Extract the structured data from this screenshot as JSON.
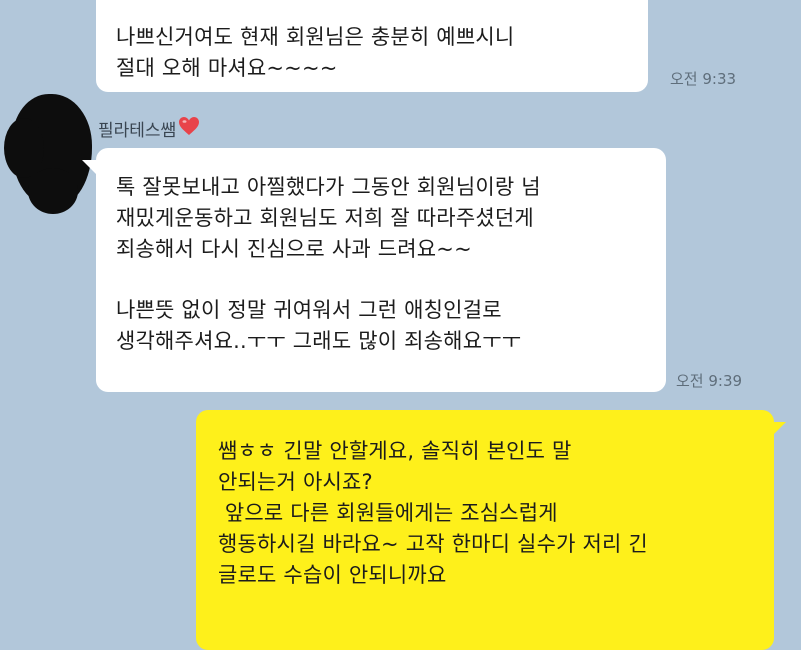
{
  "messages": {
    "first": {
      "lines": [
        "나쁘신거여도 현재 회원님은 충분히 예쁘시니",
        "절대 오해 마셔요~~~~"
      ],
      "time": "오전 9:33"
    },
    "second": {
      "sender": "필라테스쌤",
      "lines": [
        "톡 잘못보내고 아찔했다가 그동안 회원님이랑 넘",
        "재밌게운동하고 회원님도 저희 잘 따라주셨던게",
        "죄송해서 다시 진심으로 사과 드려요~~",
        "나쁜뜻 없이 정말 귀여워서 그런  애칭인걸로",
        "생각해주셔요..ㅜㅜ 그래도 많이 죄송해요ㅜㅜ"
      ],
      "time": "오전 9:39"
    },
    "third": {
      "lines": [
        "쌤ㅎㅎ 긴말 안할게요, 솔직히 본인도 말",
        "안되는거 아시죠?",
        " 앞으로 다른 회원들에게는 조심스럽게",
        "행동하시길 바라요~ 고작 한마디 실수가 저리 긴",
        "글로도 수습이 안되니까요"
      ]
    }
  },
  "colors": {
    "background": "#b2c7da",
    "incoming_bubble": "#ffffff",
    "outgoing_bubble": "#fef01b",
    "heart": "#e8434a"
  },
  "icons": {
    "sender_badge": "heart-icon",
    "avatar": "redacted-avatar"
  }
}
